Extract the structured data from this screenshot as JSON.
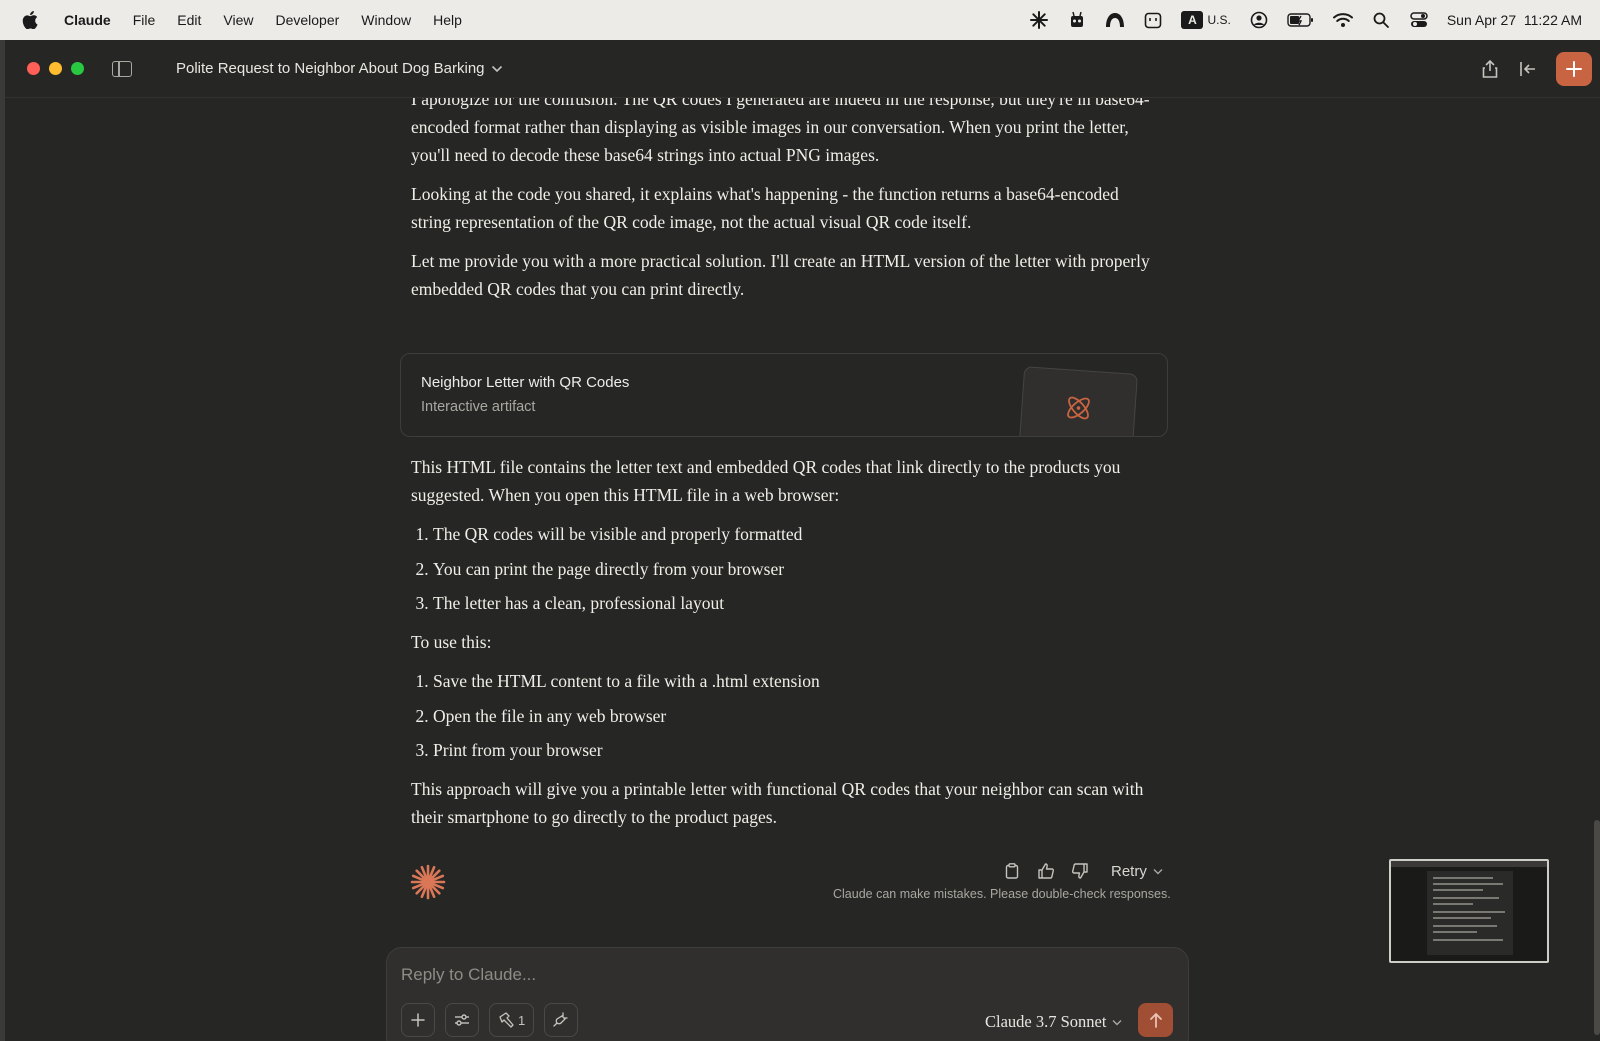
{
  "menubar": {
    "app_name": "Claude",
    "menus": [
      "File",
      "Edit",
      "View",
      "Developer",
      "Window",
      "Help"
    ],
    "input_source": "U.S.",
    "input_letter": "A",
    "datetime": "Sun Apr 27  11:22 AM"
  },
  "window": {
    "conversation_title": "Polite Request to Neighbor About Dog Barking"
  },
  "message": {
    "p1": "I apologize for the confusion. The QR codes I generated are indeed in the response, but they're in base64-encoded format rather than displaying as visible images in our conversation. When you print the letter, you'll need to decode these base64 strings into actual PNG images.",
    "p2": "Looking at the code you shared, it explains what's happening - the function returns a base64-encoded string representation of the QR code image, not the actual visual QR code itself.",
    "p3": "Let me provide you with a more practical solution. I'll create an HTML version of the letter with properly embedded QR codes that you can print directly.",
    "p4": "This HTML file contains the letter text and embedded QR codes that link directly to the products you suggested. When you open this HTML file in a web browser:",
    "list1": [
      "The QR codes will be visible and properly formatted",
      "You can print the page directly from your browser",
      "The letter has a clean, professional layout"
    ],
    "p5": "To use this:",
    "list2": [
      "Save the HTML content to a file with a .html extension",
      "Open the file in any web browser",
      "Print from your browser"
    ],
    "p6": "This approach will give you a printable letter with functional QR codes that your neighbor can scan with their smartphone to go directly to the product pages."
  },
  "artifact": {
    "title": "Neighbor Letter with QR Codes",
    "subtitle": "Interactive artifact"
  },
  "actions": {
    "retry_label": "Retry",
    "disclaimer": "Claude can make mistakes. Please double-check responses."
  },
  "composer": {
    "placeholder": "Reply to Claude...",
    "tool_count": "1",
    "model": "Claude 3.7 Sonnet"
  },
  "colors": {
    "accent": "#c96442",
    "background": "#262624",
    "text": "#f0eee8"
  }
}
